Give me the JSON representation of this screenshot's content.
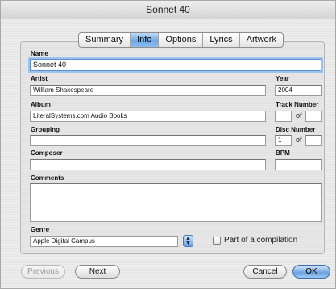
{
  "window": {
    "title": "Sonnet 40"
  },
  "tabs": [
    {
      "label": "Summary"
    },
    {
      "label": "Info"
    },
    {
      "label": "Options"
    },
    {
      "label": "Lyrics"
    },
    {
      "label": "Artwork"
    }
  ],
  "active_tab": "Info",
  "fields": {
    "name": {
      "label": "Name",
      "value": "Sonnet 40"
    },
    "artist": {
      "label": "Artist",
      "value": "William Shakespeare"
    },
    "year": {
      "label": "Year",
      "value": "2004"
    },
    "album": {
      "label": "Album",
      "value": "LiteralSystems.com Audio Books"
    },
    "track_number": {
      "label": "Track Number",
      "value": "",
      "of_label": "of",
      "total": ""
    },
    "grouping": {
      "label": "Grouping",
      "value": ""
    },
    "disc_number": {
      "label": "Disc Number",
      "value": "1",
      "of_label": "of",
      "total": ""
    },
    "composer": {
      "label": "Composer",
      "value": ""
    },
    "bpm": {
      "label": "BPM",
      "value": ""
    },
    "comments": {
      "label": "Comments",
      "value": ""
    },
    "genre": {
      "label": "Genre",
      "value": "Apple Digital Campus"
    },
    "compilation": {
      "label": "Part of a compilation",
      "checked": false
    }
  },
  "buttons": {
    "previous": "Previous",
    "next": "Next",
    "cancel": "Cancel",
    "ok": "OK"
  },
  "colors": {
    "accent": "#6fa8e6",
    "focus_ring": "#9ec2ee"
  }
}
